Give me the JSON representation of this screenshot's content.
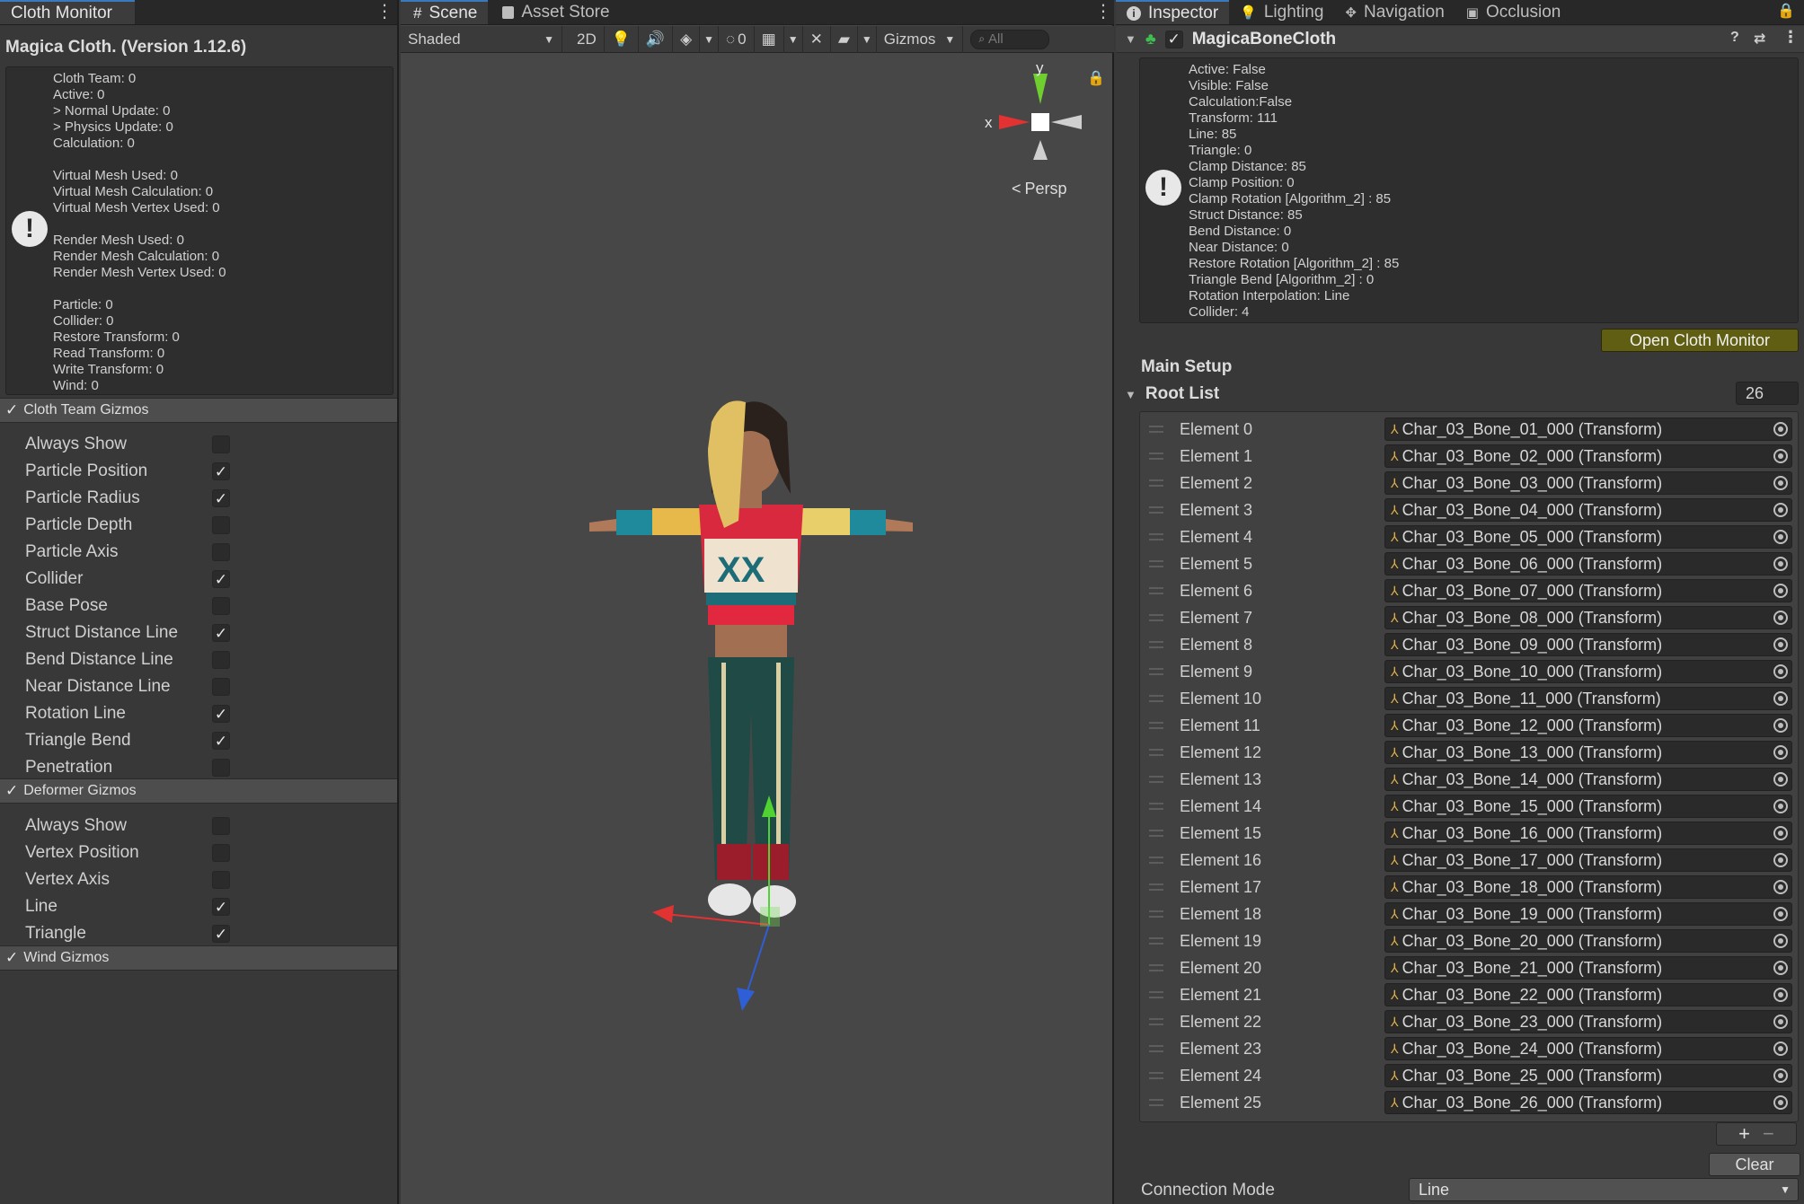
{
  "left_panel": {
    "tab": "Cloth Monitor",
    "title": "Magica Cloth. (Version 1.12.6)",
    "stats_text": "Cloth Team: 0\nActive: 0\n> Normal Update: 0\n> Physics Update: 0\nCalculation: 0\n\nVirtual Mesh Used: 0\nVirtual Mesh Calculation: 0\nVirtual Mesh Vertex Used: 0\n\nRender Mesh Used: 0\nRender Mesh Calculation: 0\nRender Mesh Vertex Used: 0\n\nParticle: 0\nCollider: 0\nRestore Transform: 0\nRead Transform: 0\nWrite Transform: 0\nWind: 0",
    "sections": [
      {
        "label": "Cloth Team Gizmos",
        "enabled": true,
        "options": [
          {
            "label": "Always Show",
            "checked": false
          },
          {
            "label": "Particle Position",
            "checked": true
          },
          {
            "label": "Particle Radius",
            "checked": true
          },
          {
            "label": "Particle Depth",
            "checked": false
          },
          {
            "label": "Particle Axis",
            "checked": false
          },
          {
            "label": "Collider",
            "checked": true
          },
          {
            "label": "Base Pose",
            "checked": false
          },
          {
            "label": "Struct Distance Line",
            "checked": true
          },
          {
            "label": "Bend Distance Line",
            "checked": false
          },
          {
            "label": "Near Distance Line",
            "checked": false
          },
          {
            "label": "Rotation Line",
            "checked": true
          },
          {
            "label": "Triangle Bend",
            "checked": true
          },
          {
            "label": "Penetration",
            "checked": false
          }
        ]
      },
      {
        "label": "Deformer Gizmos",
        "enabled": true,
        "options": [
          {
            "label": "Always Show",
            "checked": false
          },
          {
            "label": "Vertex Position",
            "checked": false
          },
          {
            "label": "Vertex Axis",
            "checked": false
          },
          {
            "label": "Line",
            "checked": true
          },
          {
            "label": "Triangle",
            "checked": true
          }
        ]
      },
      {
        "label": "Wind Gizmos",
        "enabled": true,
        "options": []
      }
    ]
  },
  "scene": {
    "tabs": [
      "Scene",
      "Asset Store"
    ],
    "shading_mode": "Shaded",
    "toggle_2d": "2D",
    "hidden_count": "0",
    "gizmos_label": "Gizmos",
    "search_placeholder": "All",
    "projection_label": "Persp",
    "axis_y": "y",
    "axis_x": "x"
  },
  "inspector": {
    "tabs": [
      "Inspector",
      "Lighting",
      "Navigation",
      "Occlusion"
    ],
    "component_name": "MagicaBoneCloth",
    "status_text": "Active: False\nVisible: False\nCalculation:False\nTransform: 111\nLine: 85\nTriangle: 0\nClamp Distance: 85\nClamp Position: 0\nClamp Rotation [Algorithm_2] : 85\nStruct Distance: 85\nBend Distance: 0\nNear Distance: 0\nRestore Rotation [Algorithm_2] : 85\nTriangle Bend [Algorithm_2] : 0\nRotation Interpolation: Line\nCollider: 4",
    "open_monitor_label": "Open Cloth Monitor",
    "main_setup_label": "Main Setup",
    "root_list_label": "Root List",
    "root_list_count": "26",
    "elements": [
      {
        "label": "Element 0",
        "value": "Char_03_Bone_01_000 (Transform)"
      },
      {
        "label": "Element 1",
        "value": "Char_03_Bone_02_000 (Transform)"
      },
      {
        "label": "Element 2",
        "value": "Char_03_Bone_03_000 (Transform)"
      },
      {
        "label": "Element 3",
        "value": "Char_03_Bone_04_000 (Transform)"
      },
      {
        "label": "Element 4",
        "value": "Char_03_Bone_05_000 (Transform)"
      },
      {
        "label": "Element 5",
        "value": "Char_03_Bone_06_000 (Transform)"
      },
      {
        "label": "Element 6",
        "value": "Char_03_Bone_07_000 (Transform)"
      },
      {
        "label": "Element 7",
        "value": "Char_03_Bone_08_000 (Transform)"
      },
      {
        "label": "Element 8",
        "value": "Char_03_Bone_09_000 (Transform)"
      },
      {
        "label": "Element 9",
        "value": "Char_03_Bone_10_000 (Transform)"
      },
      {
        "label": "Element 10",
        "value": "Char_03_Bone_11_000 (Transform)"
      },
      {
        "label": "Element 11",
        "value": "Char_03_Bone_12_000 (Transform)"
      },
      {
        "label": "Element 12",
        "value": "Char_03_Bone_13_000 (Transform)"
      },
      {
        "label": "Element 13",
        "value": "Char_03_Bone_14_000 (Transform)"
      },
      {
        "label": "Element 14",
        "value": "Char_03_Bone_15_000 (Transform)"
      },
      {
        "label": "Element 15",
        "value": "Char_03_Bone_16_000 (Transform)"
      },
      {
        "label": "Element 16",
        "value": "Char_03_Bone_17_000 (Transform)"
      },
      {
        "label": "Element 17",
        "value": "Char_03_Bone_18_000 (Transform)"
      },
      {
        "label": "Element 18",
        "value": "Char_03_Bone_19_000 (Transform)"
      },
      {
        "label": "Element 19",
        "value": "Char_03_Bone_20_000 (Transform)"
      },
      {
        "label": "Element 20",
        "value": "Char_03_Bone_21_000 (Transform)"
      },
      {
        "label": "Element 21",
        "value": "Char_03_Bone_22_000 (Transform)"
      },
      {
        "label": "Element 22",
        "value": "Char_03_Bone_23_000 (Transform)"
      },
      {
        "label": "Element 23",
        "value": "Char_03_Bone_24_000 (Transform)"
      },
      {
        "label": "Element 24",
        "value": "Char_03_Bone_25_000 (Transform)"
      },
      {
        "label": "Element 25",
        "value": "Char_03_Bone_26_000 (Transform)"
      }
    ],
    "add_label": "+",
    "remove_label": "−",
    "clear_label": "Clear",
    "connection_mode_label": "Connection Mode",
    "connection_mode_value": "Line"
  },
  "colors": {
    "accent": "#3a79bb",
    "open_monitor_button": "#5f5e13",
    "component_icon": "#3fbf4f"
  }
}
